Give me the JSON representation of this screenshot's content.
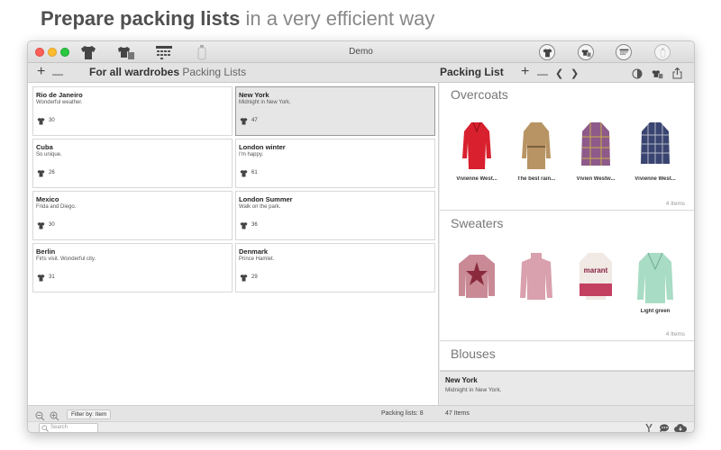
{
  "promo": {
    "headline_bold": "Prepare packing lists",
    "headline_light": "in a very efficient way"
  },
  "window": {
    "title": "Demo",
    "toolbar_icons": [
      "shirt-icon",
      "wardrobe-icon",
      "calendar-icon",
      "bottle-icon",
      "shirt-icon",
      "wardrobe-icon",
      "calendar-icon",
      "bottle-icon"
    ]
  },
  "left_toolbar": {
    "add_label": "+",
    "remove_label": "—",
    "title_bold": "For all wardrobes",
    "title_light": "Packing Lists"
  },
  "right_toolbar": {
    "title": "Packing List",
    "add_label": "+",
    "remove_label": "—",
    "prev_label": "❮",
    "next_label": "❯"
  },
  "packing_lists": [
    {
      "title": "Rio de Janeiro",
      "subtitle": "Wonderful weather.",
      "count": "30",
      "selected": false
    },
    {
      "title": "New York",
      "subtitle": "Midnight in New York.",
      "count": "47",
      "selected": true
    },
    {
      "title": "Cuba",
      "subtitle": "So unique.",
      "count": "26",
      "selected": false
    },
    {
      "title": "London winter",
      "subtitle": "I'm happy.",
      "count": "61",
      "selected": false
    },
    {
      "title": "Mexico",
      "subtitle": "Frida and Diego.",
      "count": "30",
      "selected": false
    },
    {
      "title": "London Summer",
      "subtitle": "Walk on the park.",
      "count": "36",
      "selected": false
    },
    {
      "title": "Berlin",
      "subtitle": "Firts visit. Wonderful city.",
      "count": "31",
      "selected": false
    },
    {
      "title": "Denmark",
      "subtitle": "Prince Hamlet.",
      "count": "29",
      "selected": false
    }
  ],
  "sections": [
    {
      "title": "Overcoats",
      "count_label": "4 Items",
      "items": [
        {
          "label": "Vivienne West...",
          "color": "#d8202e"
        },
        {
          "label": "The best rain...",
          "color": "#b89464"
        },
        {
          "label": "Vivien Westw...",
          "color": "#8e5a8a"
        },
        {
          "label": "Vivienne West...",
          "color": "#3a4470"
        }
      ]
    },
    {
      "title": "Sweaters",
      "count_label": "4 Items",
      "items": [
        {
          "label": "",
          "color": "#c98a96"
        },
        {
          "label": "",
          "color": "#d9a0ad"
        },
        {
          "label": "",
          "color": "#f0e9e4"
        },
        {
          "label": "Light green",
          "color": "#a8dcc4"
        }
      ]
    },
    {
      "title": "Blouses",
      "count_label": "",
      "items": []
    }
  ],
  "sweater_logo_text": "marant",
  "detail": {
    "title": "New York",
    "subtitle": "Midnight in New York."
  },
  "footer": {
    "filter_label": "Filter by: Item",
    "packing_lists_count": "Packing lists: 8",
    "items_count": "47 Items",
    "search_placeholder": "Search"
  }
}
